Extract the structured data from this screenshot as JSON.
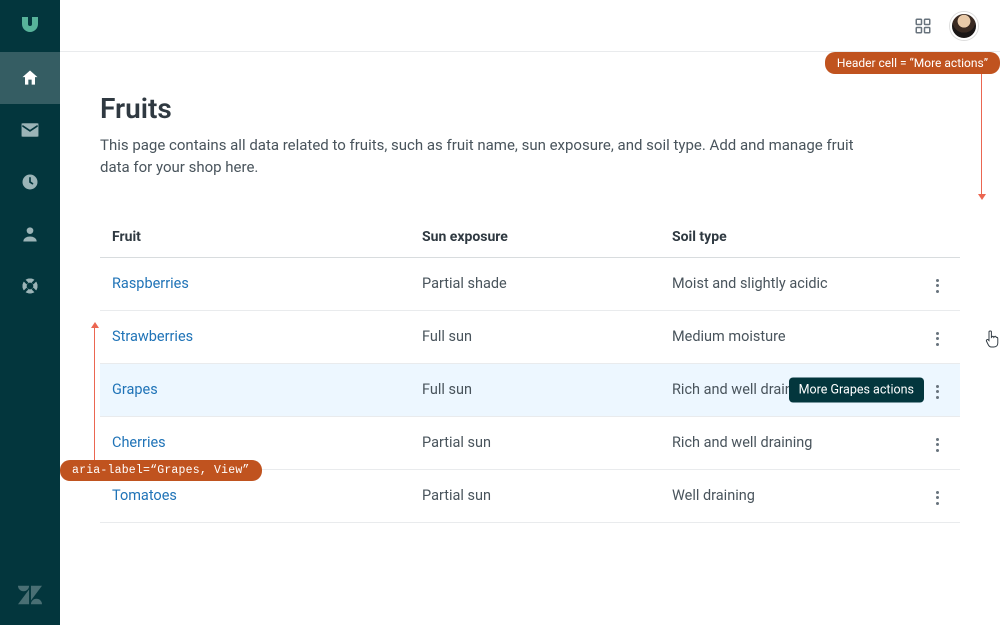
{
  "page": {
    "title": "Fruits",
    "subtitle": "This page contains all data related to fruits, such as fruit name, sun exposure, and soil type. Add and manage fruit data for your shop here."
  },
  "table": {
    "headers": {
      "fruit": "Fruit",
      "sun": "Sun exposure",
      "soil": "Soil type",
      "actions_aria": "More actions"
    },
    "rows": [
      {
        "fruit": "Raspberries",
        "sun": "Partial shade",
        "soil": "Moist and slightly acidic"
      },
      {
        "fruit": "Strawberries",
        "sun": "Full sun",
        "soil": "Medium moisture"
      },
      {
        "fruit": "Grapes",
        "sun": "Full sun",
        "soil": "Rich and well draining",
        "hovered": true,
        "tooltip": "More Grapes actions"
      },
      {
        "fruit": "Cherries",
        "sun": "Partial sun",
        "soil": "Rich and well draining"
      },
      {
        "fruit": "Tomatoes",
        "sun": "Partial sun",
        "soil": "Well draining"
      }
    ]
  },
  "annotations": {
    "header_cell": "Header cell = “More actions”",
    "aria_label": "aria-label=“Grapes, View”"
  },
  "sidebar": {
    "items": [
      "home",
      "mail",
      "clock",
      "user",
      "help"
    ]
  }
}
